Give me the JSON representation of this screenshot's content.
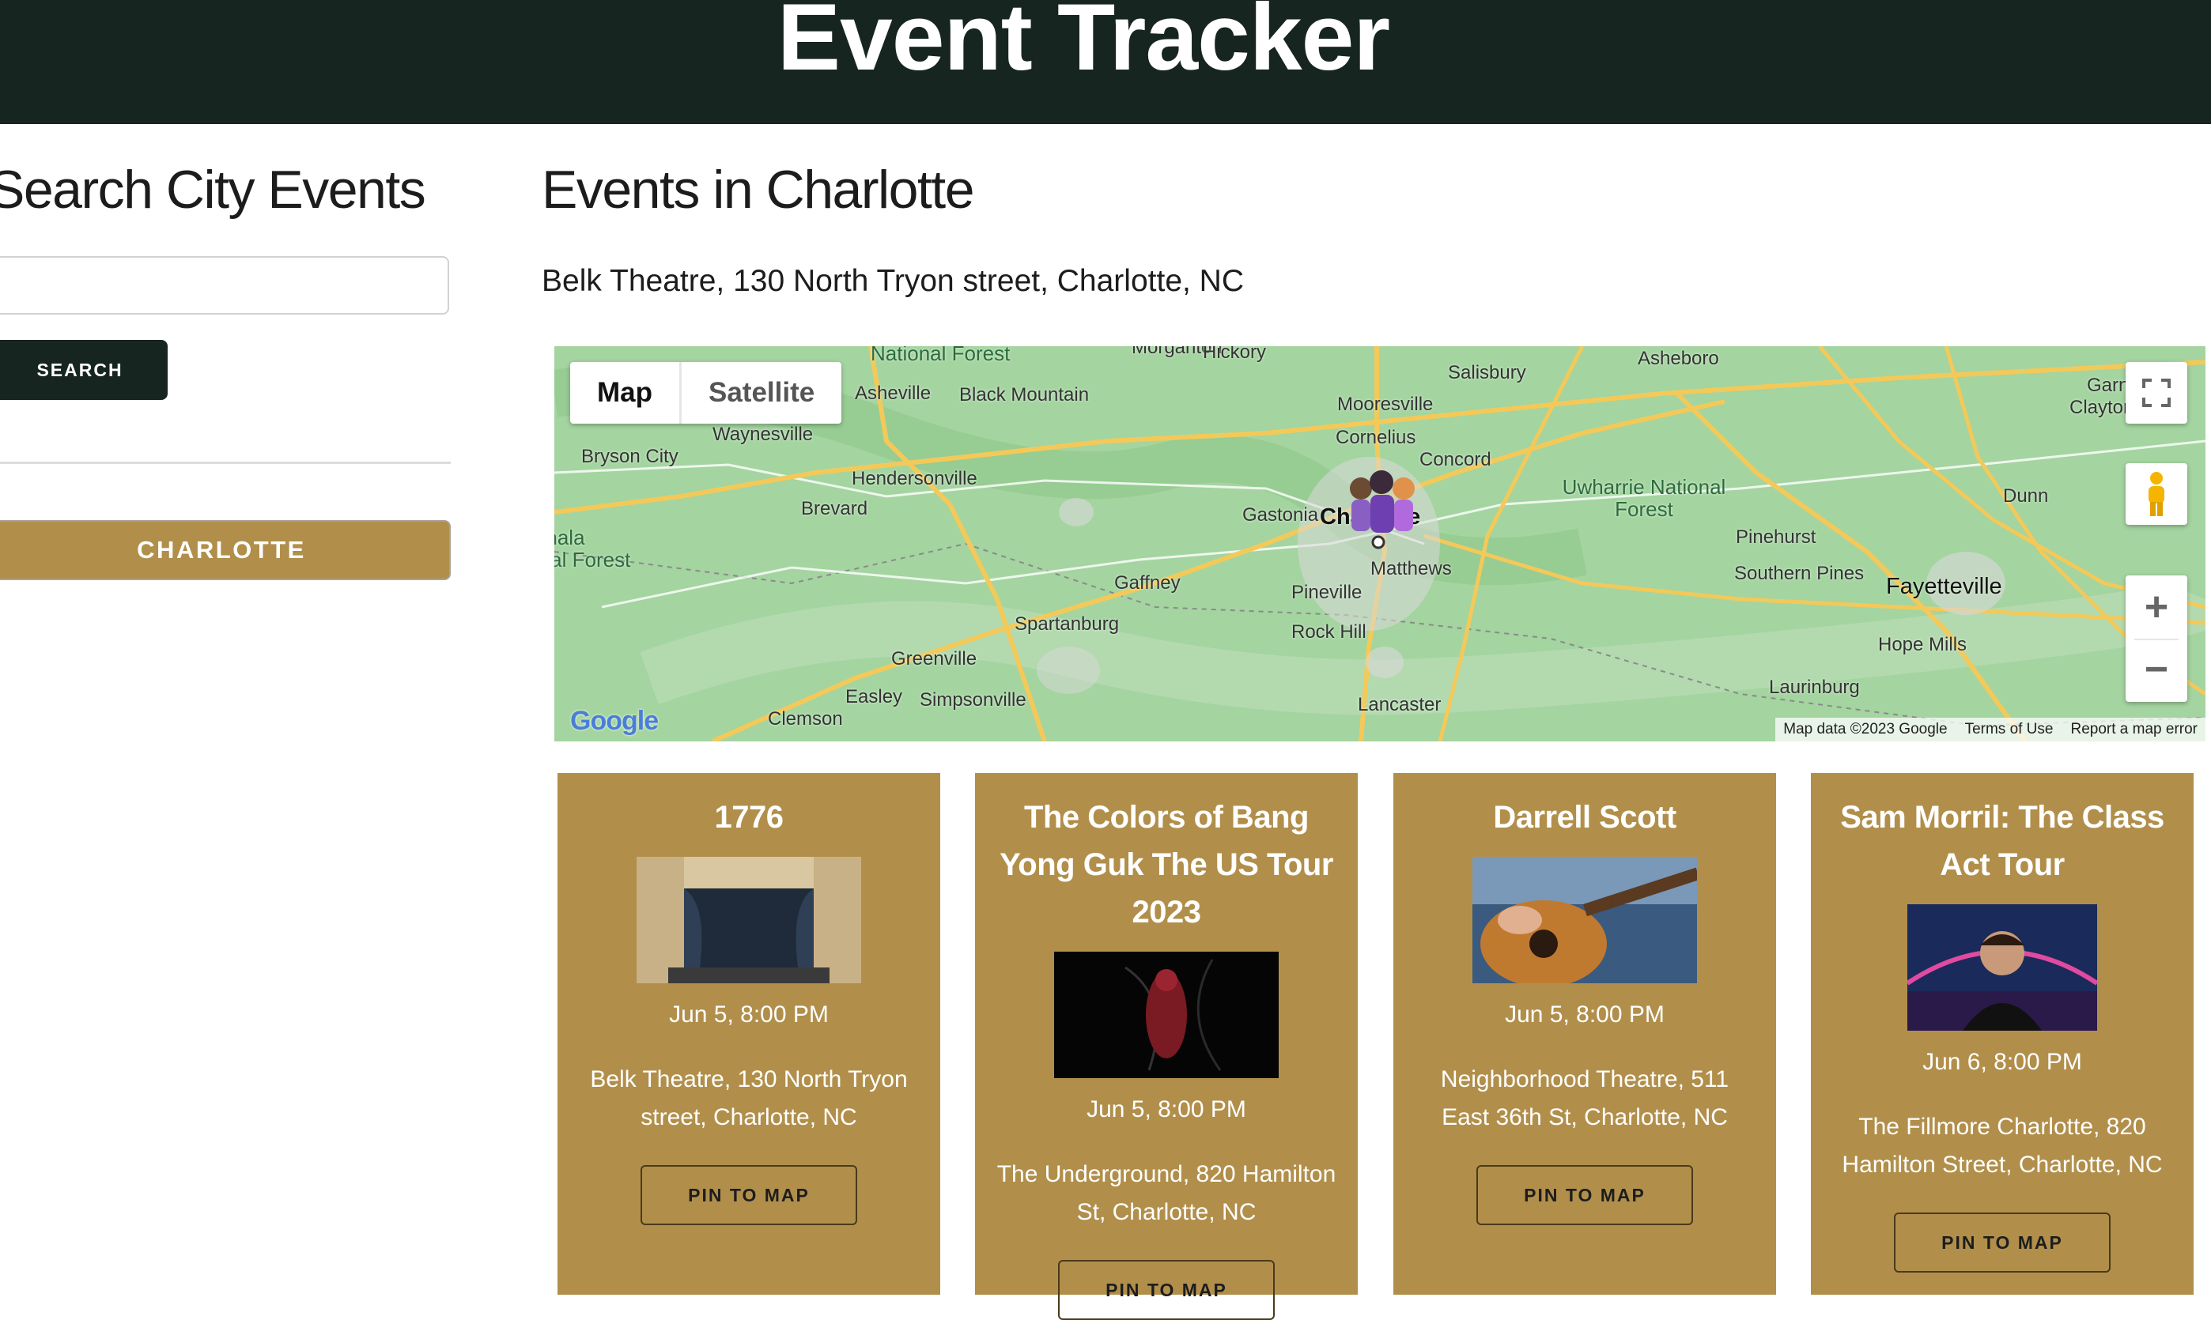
{
  "header": {
    "title": "Event Tracker"
  },
  "sidebar": {
    "title": "Search City Events",
    "search_value": "",
    "search_button": "SEARCH",
    "history": [
      {
        "label": "CHARLOTTE"
      }
    ]
  },
  "main": {
    "title": "Events in Charlotte",
    "selected_venue": "Belk Theatre, 130 North Tryon street, Charlotte, NC"
  },
  "map": {
    "type_map": "Map",
    "type_satellite": "Satellite",
    "logo": "Google",
    "attribution": "Map data ©2023 Google",
    "terms": "Terms of Use",
    "report": "Report a map error",
    "zoom_in": "+",
    "zoom_out": "−",
    "places": [
      "National Forest",
      "Morganton",
      "Hickory",
      "Salisbury",
      "Asheboro",
      "Garner",
      "Clayton",
      "Asheville",
      "Black Mountain",
      "Mooresville",
      "Cornelius",
      "Concord",
      "Bryson City",
      "Waynesville",
      "Hendersonville",
      "Brevard",
      "Gastonia",
      "Charlotte",
      "Uwharrie National Forest",
      "Pinehurst",
      "Southern Pines",
      "Fayetteville",
      "Dunn",
      "Nantahala National Forest",
      "Gaffney",
      "Matthews",
      "Pineville",
      "Spartanburg",
      "Rock Hill",
      "Hope Mills",
      "Greenville",
      "Easley",
      "Simpsonville",
      "Clemson",
      "Lancaster",
      "Laurinburg"
    ],
    "colors": {
      "land": "#9fd19c",
      "roads": "#f3c95a",
      "minor_roads": "#ffffff"
    }
  },
  "events": [
    {
      "title": "1776",
      "date": "Jun 5, 8:00 PM",
      "venue": "Belk Theatre, 130 North Tryon street, Charlotte, NC",
      "button": "PIN TO MAP",
      "image": "theatre-stage"
    },
    {
      "title": "The Colors of Bang Yong Guk The US Tour 2023",
      "date": "Jun 5, 8:00 PM",
      "venue": "The Underground, 820 Hamilton St, Charlotte, NC",
      "button": "PIN TO MAP",
      "image": "red-figure-dark"
    },
    {
      "title": "Darrell Scott",
      "date": "Jun 5, 8:00 PM",
      "venue": "Neighborhood Theatre, 511 East 36th St, Charlotte, NC",
      "button": "PIN TO MAP",
      "image": "acoustic-guitar"
    },
    {
      "title": "Sam Morril: The Class Act Tour",
      "date": "Jun 6, 8:00 PM",
      "venue": "The Fillmore Charlotte, 820 Hamilton Street, Charlotte, NC",
      "button": "PIN TO MAP",
      "image": "comedian-portrait"
    }
  ],
  "theme": {
    "header_bg": "#172520",
    "accent": "#b18f4b"
  }
}
